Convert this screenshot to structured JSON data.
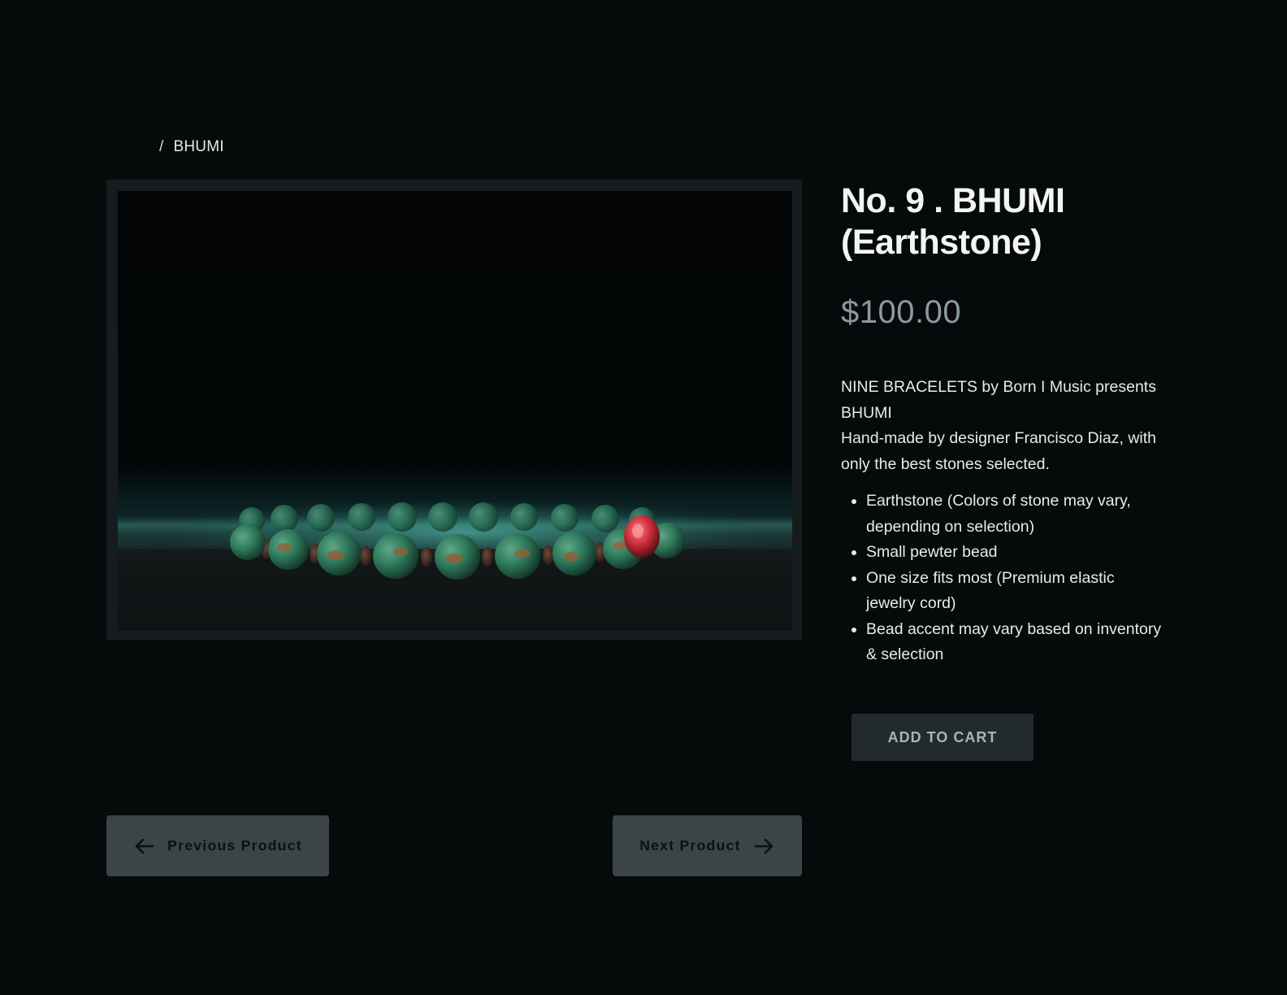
{
  "breadcrumb": {
    "separator": "/",
    "current": "BHUMI"
  },
  "product": {
    "title": "No. 9 . BHUMI (Earthstone)",
    "price": "$100.00",
    "image_alt": "bracelet-photo",
    "description_lines": [
      "NINE BRACELETS by Born I Music presents BHUMI",
      "Hand-made by designer Francisco Diaz, with only the best stones selected."
    ],
    "features": [
      "Earthstone (Colors of stone may vary, depending on selection)",
      "Small pewter bead",
      "One size fits most (Premium elastic jewelry cord)",
      "Bead accent may vary based on inventory & selection"
    ],
    "add_to_cart_label": "ADD TO CART"
  },
  "navigation": {
    "previous_label": "Previous Product",
    "next_label": "Next Product"
  },
  "colors": {
    "background": "#070a0b",
    "price": "#8c9aa0",
    "button_dark": "#232a2d",
    "nav_button": "#3b4447",
    "bead_green": "#2f7a5c",
    "accent_bead": "#c92b3a"
  },
  "icons": {
    "previous": "arrow-left-icon",
    "next": "arrow-right-icon"
  }
}
